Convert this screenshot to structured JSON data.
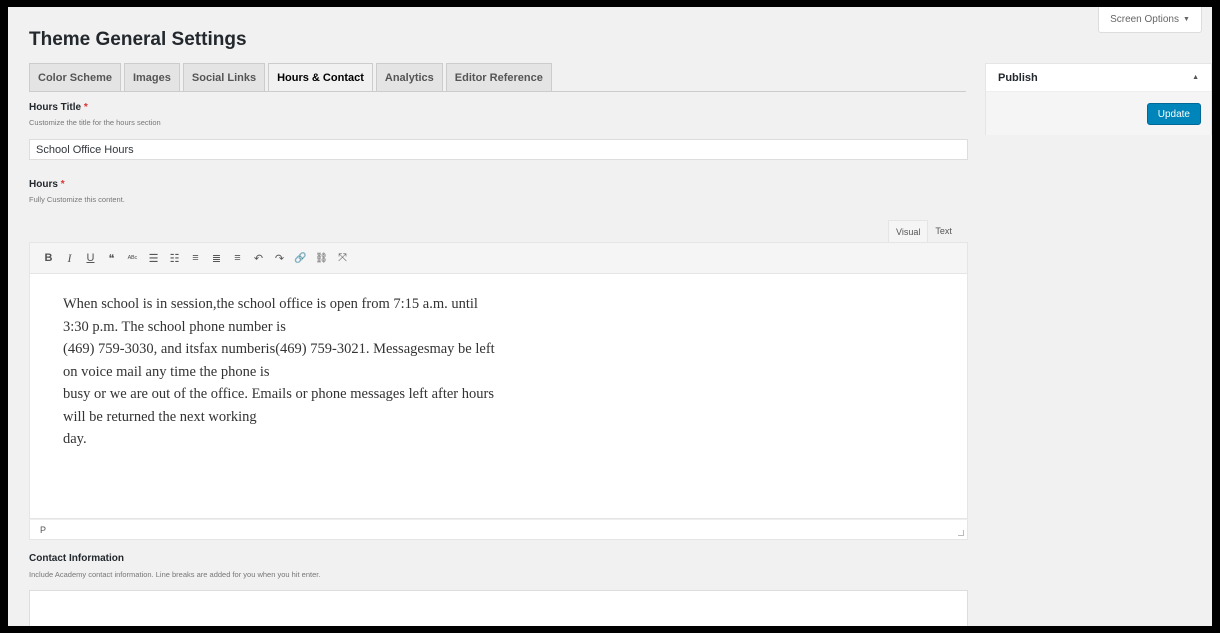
{
  "screen_options": {
    "label": "Screen Options"
  },
  "page_title": "Theme General Settings",
  "tabs": [
    {
      "label": "Color Scheme",
      "active": false
    },
    {
      "label": "Images",
      "active": false
    },
    {
      "label": "Social Links",
      "active": false
    },
    {
      "label": "Hours & Contact",
      "active": true
    },
    {
      "label": "Analytics",
      "active": false
    },
    {
      "label": "Editor Reference",
      "active": false
    }
  ],
  "hours_title": {
    "label": "Hours Title",
    "required_mark": "*",
    "description": "Customize the title for the hours section",
    "value": "School Office Hours"
  },
  "hours": {
    "label": "Hours",
    "required_mark": "*",
    "description": "Fully Customize this content.",
    "editor_tabs": {
      "visual": "Visual",
      "text": "Text"
    },
    "toolbar": {
      "bold": "B",
      "italic": "I",
      "underline": "U",
      "blockquote": "❝",
      "strikethrough": "ᴬᴮᶜ",
      "bullet_list": "☰",
      "numbered_list": "☷",
      "align_left": "≡",
      "align_center": "≣",
      "align_right": "≡",
      "undo": "↶",
      "redo": "↷",
      "link": "🔗",
      "unlink": "⛓",
      "fullscreen": "⤧"
    },
    "content_lines": [
      "When school is in session,the school office is open from 7:15 a.m. until",
      "3:30 p.m. The school phone number is",
      "(469) 759-3030, and itsfax numberis(469) 759-3021. Messagesmay be left",
      "on voice mail any time the phone is",
      "busy or we are out of the office. Emails or phone messages left after hours",
      "will be returned the next working",
      "day."
    ],
    "status_path": "P"
  },
  "contact_information": {
    "label": "Contact Information",
    "description": "Include Academy contact information. Line breaks are added for you when you hit enter.",
    "value": ""
  },
  "publish": {
    "title": "Publish",
    "update_label": "Update"
  },
  "colors": {
    "accent": "#0085ba",
    "required": "#dc3232",
    "background": "#f1f1f1"
  }
}
